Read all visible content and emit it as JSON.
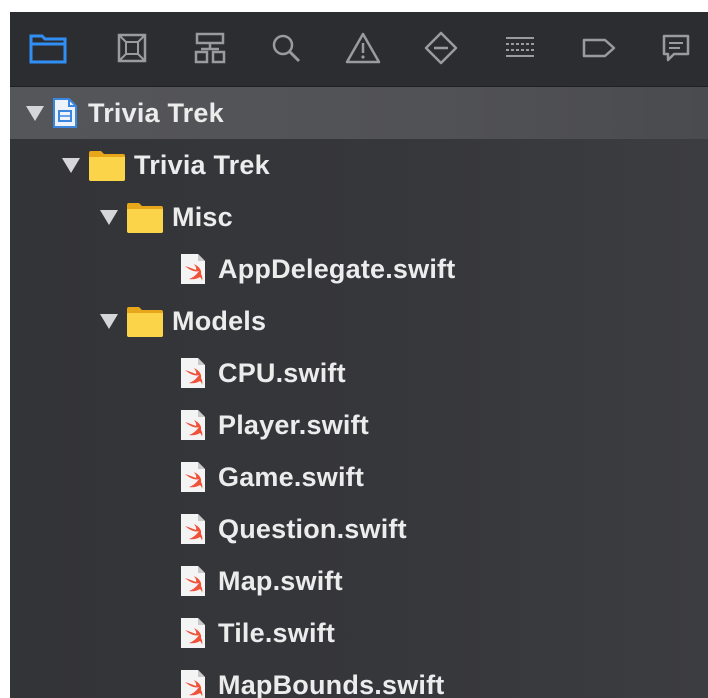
{
  "toolbar": {
    "items": [
      {
        "name": "project-navigator",
        "icon": "folder-icon",
        "selected": true
      },
      {
        "name": "source-control-navigator",
        "icon": "source-control-icon",
        "selected": false
      },
      {
        "name": "symbol-navigator",
        "icon": "hierarchy-icon",
        "selected": false
      },
      {
        "name": "find-navigator",
        "icon": "search-icon",
        "selected": false
      },
      {
        "name": "issue-navigator",
        "icon": "warning-icon",
        "selected": false
      },
      {
        "name": "test-navigator",
        "icon": "test-diamond-icon",
        "selected": false
      },
      {
        "name": "debug-navigator",
        "icon": "debug-list-icon",
        "selected": false
      },
      {
        "name": "breakpoint-navigator",
        "icon": "breakpoint-tag-icon",
        "selected": false
      },
      {
        "name": "report-navigator",
        "icon": "report-bubble-icon",
        "selected": false
      }
    ],
    "selected_color": "#2f8ff5",
    "icon_color": "#9a9b9f"
  },
  "tree": {
    "project": {
      "label": "Trivia Trek",
      "icon": "project-file-icon"
    },
    "group": {
      "label": "Trivia Trek",
      "icon": "folder-icon"
    },
    "misc": {
      "label": "Misc",
      "icon": "folder-icon"
    },
    "misc_files": [
      {
        "label": "AppDelegate.swift",
        "icon": "swift-file-icon"
      }
    ],
    "models": {
      "label": "Models",
      "icon": "folder-icon"
    },
    "model_files": [
      {
        "label": "CPU.swift",
        "icon": "swift-file-icon"
      },
      {
        "label": "Player.swift",
        "icon": "swift-file-icon"
      },
      {
        "label": "Game.swift",
        "icon": "swift-file-icon"
      },
      {
        "label": "Question.swift",
        "icon": "swift-file-icon"
      },
      {
        "label": "Map.swift",
        "icon": "swift-file-icon"
      },
      {
        "label": "Tile.swift",
        "icon": "swift-file-icon"
      },
      {
        "label": "MapBounds.swift",
        "icon": "swift-file-icon"
      }
    ]
  }
}
